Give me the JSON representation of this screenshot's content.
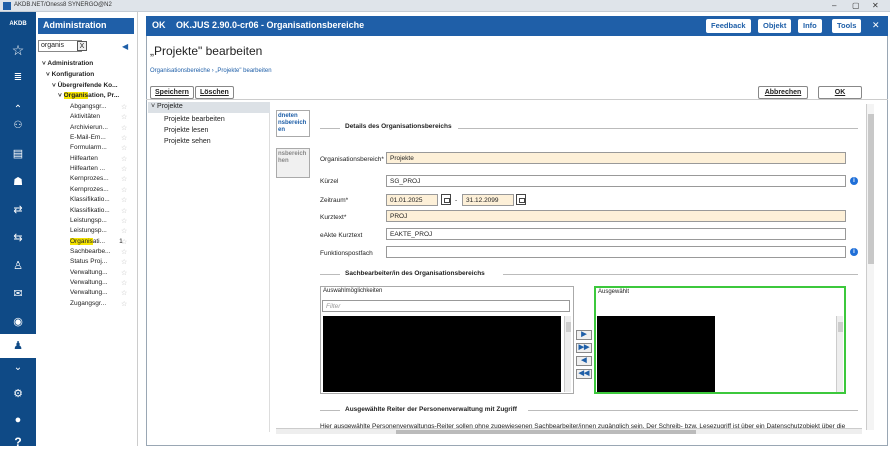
{
  "titlebar": {
    "title": "AKDB.NET/Oness8 SYNERGO@N2",
    "minimize": "–",
    "restore": "▢",
    "close": "✕"
  },
  "iconbar": {
    "logo": "AKDB"
  },
  "nav": {
    "header": "Administration",
    "search_value": "organis",
    "search_clear": "X",
    "collapse": "◀",
    "tree": [
      {
        "label": "Administration",
        "expander": "˅"
      },
      {
        "label": "Konfiguration",
        "expander": "˅"
      },
      {
        "label": "Übergreifende Ko...",
        "expander": "˅"
      },
      {
        "label_hl": "Organis",
        "label_rest": "ation, Pr...",
        "expander": "˅"
      }
    ],
    "items": [
      "Abgangsgr...",
      "Aktivitäten",
      "Archivierun...",
      "E-Mail-Em...",
      "Formularm...",
      "Hilfearten",
      "Hilfearten ...",
      "Kernprozes...",
      "Kernprozes...",
      "Klassifikatio...",
      "Klassifikatio...",
      "Leistungsp...",
      "Leistungsp...",
      "Organisati...",
      "Sachbearbe...",
      "Status Proj...",
      "Verwaltung...",
      "Verwaltung...",
      "Verwaltung...",
      "Zugangsgr..."
    ],
    "selected_hl": "Organis",
    "selected_rest": "ati...",
    "selected_count": "1"
  },
  "window": {
    "logo": "OK",
    "title": "OK.JUS 2.90.0-cr06 - Organisationsbereiche",
    "buttons": [
      "Feedback",
      "Objekt",
      "Info",
      "Tools"
    ],
    "close": "✕",
    "page_title": "„Projekte\" bearbeiten",
    "breadcrumb": "Organisationsbereiche › „Projekte\" bearbeiten",
    "save": "Speichern",
    "delete": "Löschen",
    "cancel": "Abbrechen",
    "ok": "OK"
  },
  "tree2": {
    "root": "Projekte",
    "root_expander": "˅",
    "items": [
      "Projekte bearbeiten",
      "Projekte lesen",
      "Projekte sehen"
    ]
  },
  "tabs": {
    "active": [
      "dneten",
      "nsbereich",
      "en"
    ],
    "inactive": [
      "nsbereich",
      "hen"
    ]
  },
  "form": {
    "section1": "Details des Organisationsbereichs",
    "org_label": "Organisationsbereich*",
    "org_value": "Projekte",
    "kuerzel_label": "Kürzel",
    "kuerzel_value": "SG_PROJ",
    "zeitraum_label": "Zeitraum*",
    "from": "01.01.2025",
    "dash": "-",
    "to": "31.12.2099",
    "kurztext_label": "Kurztext*",
    "kurztext_value": "PROJ",
    "eakte_label": "eAkte Kurztext",
    "eakte_value": "EAKTE_PROJ",
    "funktion_label": "Funktionspostfach",
    "funktion_value": "",
    "info_glyph": "i",
    "section2": "Sachbearbeiter/in des Organisationsbereichs",
    "avail_caption": "Auswahlmöglichkeiten",
    "filter_placeholder": "Filter",
    "sel_caption": "Ausgewählt",
    "arrows": [
      "▶",
      "▶▶",
      "◀",
      "◀◀"
    ],
    "section3": "Ausgewählte Reiter der Personenverwaltung mit Zugriff",
    "bottom_text": "Hier ausgewählte Personenverwaltungs-Reiter sollen ohne zugewiesenen Sachbearbeiter/innen zugänglich sein. Der Schreib- bzw. Lesezugriff ist über ein Datenschutzobjekt über die"
  },
  "colors": {
    "brand": "#1f5fa8",
    "dark": "#0f4a86",
    "required": "#fdf0d8",
    "selected_border": "#3cc83c",
    "highlight": "#f5e400"
  }
}
